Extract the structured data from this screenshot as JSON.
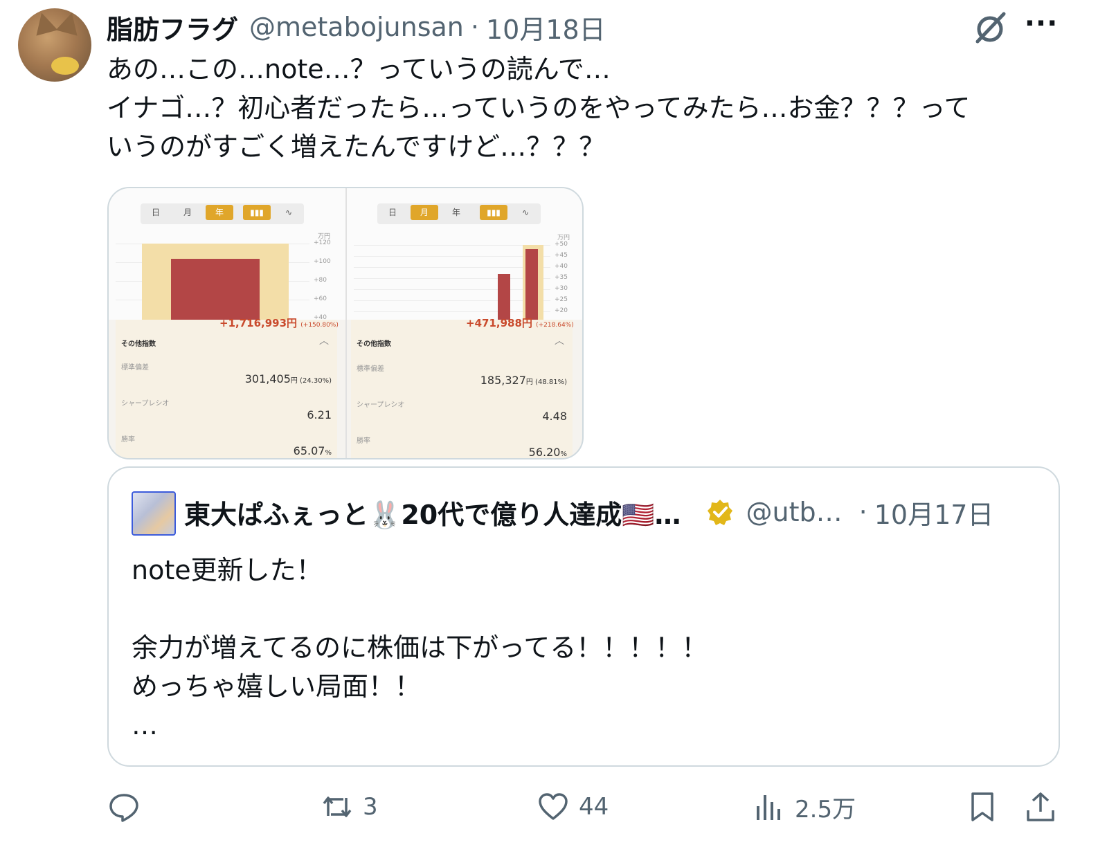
{
  "post": {
    "author_name": "脂肪フラグ",
    "handle": "@metabojunsan",
    "separator": "·",
    "date": "10月18日",
    "text_lines": [
      "あの…この…note…？っていうの読んで…",
      "イナゴ…？初心者だったら…っていうのをやってみたら…お金？？？って",
      "いうのがすごく増えたんですけど…？？？"
    ],
    "icons": {
      "grok": "grok-slash-icon",
      "more": "more-dots-icon"
    },
    "more_glyph": "···"
  },
  "media": {
    "left": {
      "tabs": [
        "日",
        "月",
        "年"
      ],
      "active_tab": "年",
      "unit": "万円",
      "ticks": [
        "+120",
        "+100",
        "+80",
        "+60",
        "+40"
      ],
      "delta": "+1,716,993円",
      "delta_pct": "(+150.80%)",
      "section_title": "その他指数",
      "stats": [
        {
          "label": "標準偏差",
          "value": "301,405",
          "suffix": "円 (24.30%)"
        },
        {
          "label": "シャープレシオ",
          "value": "6.21",
          "suffix": ""
        },
        {
          "label": "勝率",
          "value": "65.07",
          "suffix": "%"
        }
      ]
    },
    "right": {
      "tabs": [
        "日",
        "月",
        "年"
      ],
      "active_tab": "月",
      "unit": "万円",
      "ticks": [
        "+50",
        "+45",
        "+40",
        "+35",
        "+30",
        "+25",
        "+20"
      ],
      "delta": "+471,988円",
      "delta_pct": "(+218.64%)",
      "section_title": "その他指数",
      "stats": [
        {
          "label": "標準偏差",
          "value": "185,327",
          "suffix": "円 (48.81%)"
        },
        {
          "label": "シャープレシオ",
          "value": "4.48",
          "suffix": ""
        },
        {
          "label": "勝率",
          "value": "56.20",
          "suffix": "%"
        }
      ]
    },
    "colors": {
      "bar": "#b34646",
      "highlight": "#f3dea8",
      "active_tab": "#e0a62a"
    }
  },
  "quote": {
    "author_name": "東大ぱふぇっと🐰20代で億り人達成🇺🇸…",
    "handle": "@utb…",
    "separator": "·",
    "date": "10月17日",
    "text_lines": [
      "note更新した！",
      "",
      "余力が増えてるのに株価は下がってる！！！！！",
      "めっちゃ嬉しい局面！！",
      "…"
    ],
    "badge_color": "#e2b719"
  },
  "actions": {
    "reply": {
      "icon": "reply-icon",
      "count": ""
    },
    "repost": {
      "icon": "repost-icon",
      "count": "3"
    },
    "like": {
      "icon": "heart-icon",
      "count": "44"
    },
    "views": {
      "icon": "views-chart-icon",
      "count": "2.5万"
    },
    "bookmark": {
      "icon": "bookmark-icon"
    },
    "share": {
      "icon": "share-icon"
    }
  }
}
